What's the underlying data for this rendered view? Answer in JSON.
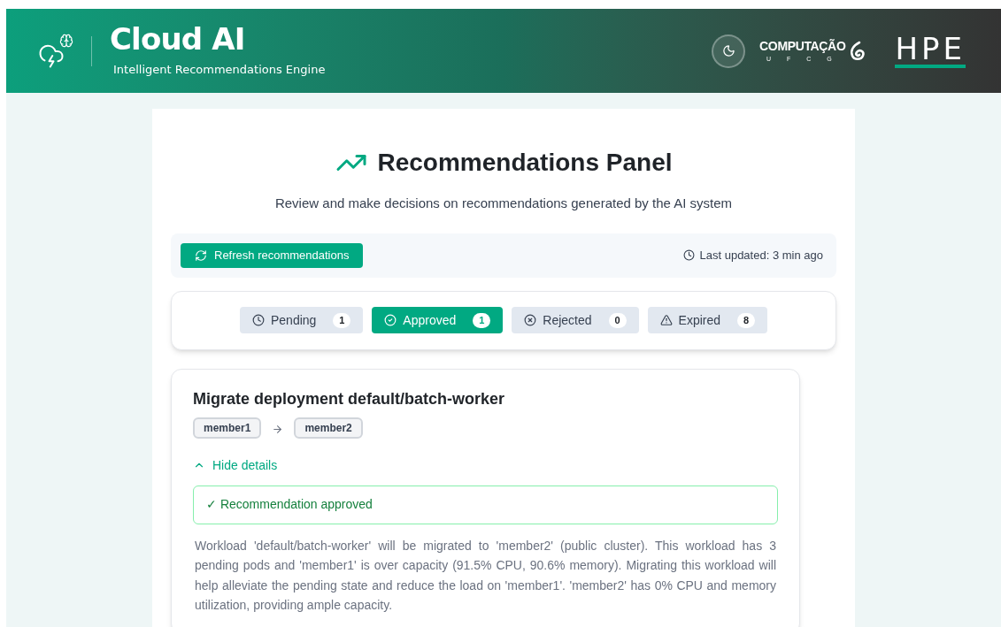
{
  "header": {
    "title": "Cloud AI",
    "subtitle": "Intelligent Recommendations Engine",
    "partner_logo": {
      "name": "COMPUTAÇÃO",
      "sub": "U F C G"
    },
    "company_logo": "HPE"
  },
  "panel": {
    "title": "Recommendations Panel",
    "description": "Review and make decisions on recommendations generated by the AI system",
    "refresh_button": "Refresh recommendations",
    "last_updated": "Last updated: 3 min ago",
    "tabs": [
      {
        "kind": "pending",
        "label": "Pending",
        "count": "1",
        "selected": false
      },
      {
        "kind": "approved",
        "label": "Approved",
        "count": "1",
        "selected": true
      },
      {
        "kind": "rejected",
        "label": "Rejected",
        "count": "0",
        "selected": false
      },
      {
        "kind": "expired",
        "label": "Expired",
        "count": "8",
        "selected": false
      }
    ],
    "recommendation": {
      "title": "Migrate deployment default/batch-worker",
      "source": "member1",
      "target": "member2",
      "details_toggle": "Hide details",
      "expanded": true,
      "status": "✓ Recommendation approved",
      "description": "Workload 'default/batch-worker' will be migrated to 'member2' (public cluster). This workload has 3 pending pods and 'member1' is over capacity (91.5% CPU, 90.6% memory). Migrating this workload will help alleviate the pending state and reduce the load on 'member1'. 'member2' has 0% CPU and memory utilization, providing ample capacity."
    }
  }
}
